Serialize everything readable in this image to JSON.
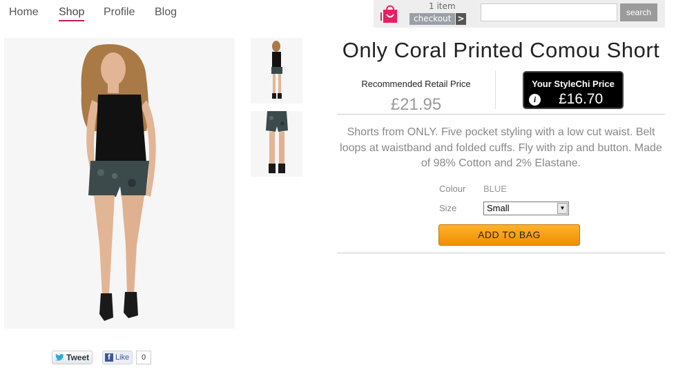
{
  "nav": {
    "items": [
      {
        "label": "Home",
        "active": false
      },
      {
        "label": "Shop",
        "active": true
      },
      {
        "label": "Profile",
        "active": false
      },
      {
        "label": "Blog",
        "active": false
      }
    ]
  },
  "cart": {
    "count_text": "1 item",
    "checkout_label": "checkout",
    "arrow": ">"
  },
  "search": {
    "value": "",
    "placeholder": "",
    "button_label": "search"
  },
  "product": {
    "title": "Only Coral Printed Comou Short",
    "rrp_label": "Recommended Retail Price",
    "rrp_value": "£21.95",
    "our_price_label": "Your StyleChi Price",
    "our_price_value": "£16.70",
    "description": "Shorts from ONLY. Five pocket styling with a low cut waist. Belt loops at waistband and folded cuffs. Fly with zip and button. Made of 98% Cotton and 2% Elastane.",
    "colour_label": "Colour",
    "colour_value": "BLUE",
    "size_label": "Size",
    "size_selected": "Small",
    "add_button": "ADD TO BAG"
  },
  "social": {
    "tweet_label": "Tweet",
    "like_label": "Like",
    "like_count": "0"
  },
  "colors": {
    "accent": "#c2185b",
    "bag_pink": "#e91e63",
    "add_button": "#f5a000"
  }
}
